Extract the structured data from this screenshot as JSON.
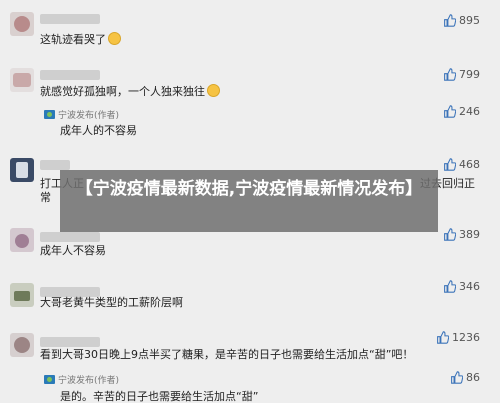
{
  "overlay": {
    "title": "【宁波疫情最新数据,宁波疫情最新情况发布】"
  },
  "comments": [
    {
      "text": "这轨迹看哭了",
      "likes": "895",
      "emoji": "crying-face"
    },
    {
      "text": "就感觉好孤独啊，一个人独来独往",
      "likes": "799",
      "emoji": "sad-face",
      "reply": {
        "author": "宁波发布(作者)",
        "text": "成年人的不容易"
      }
    },
    {
      "text": "打工人正",
      "text_tail": "过去回归正",
      "text2": "常",
      "likes": "246"
    },
    {
      "likes": "468"
    },
    {
      "text": "成年人不容易",
      "likes": "389"
    },
    {
      "text": "大哥老黄牛类型的工薪阶层啊",
      "likes": "346"
    },
    {
      "text": "看到大哥30日晚上9点半买了糖果，是辛苦的日子也需要给生活加点“甜”吧！",
      "likes": "1236",
      "reply": {
        "author": "宁波发布(作者)",
        "text": "是的。辛苦的日子也需要给生活加点“甜”",
        "likes": "86"
      }
    }
  ],
  "icons": {
    "like": "thumbs-up-icon",
    "author_tag": "official-account-icon"
  },
  "colors": {
    "background": "#eeeeee",
    "overlay": "#6e6e6e",
    "overlay_text": "#ffffff"
  }
}
